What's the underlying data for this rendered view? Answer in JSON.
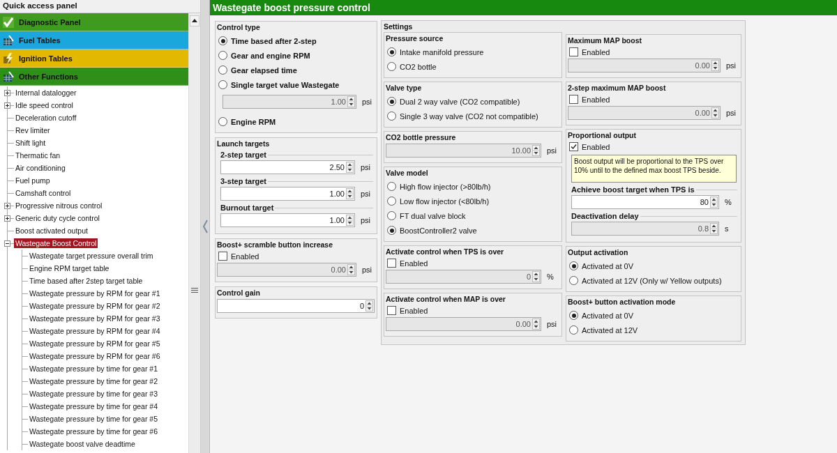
{
  "quick_access_panel": {
    "title": "Quick access panel",
    "categories": [
      {
        "label": "Diagnostic Panel",
        "color": "#3f9b1f"
      },
      {
        "label": "Fuel Tables",
        "color": "#1aa7dc"
      },
      {
        "label": "Ignition Tables",
        "color": "#e2b900"
      },
      {
        "label": "Other Functions",
        "color": "#2f8f19"
      }
    ],
    "tree": [
      {
        "label": "Internal datalogger",
        "expanded": false,
        "selected": false
      },
      {
        "label": "Idle speed control",
        "expanded": false,
        "selected": false
      },
      {
        "label": "Deceleration cutoff",
        "selected": false
      },
      {
        "label": "Rev limiter",
        "selected": false
      },
      {
        "label": "Shift light",
        "selected": false
      },
      {
        "label": "Thermatic fan",
        "selected": false
      },
      {
        "label": "Air conditioning",
        "selected": false
      },
      {
        "label": "Fuel pump",
        "selected": false
      },
      {
        "label": "Camshaft control",
        "selected": false
      },
      {
        "label": "Progressive nitrous control",
        "expanded": false,
        "selected": false
      },
      {
        "label": "Generic duty cycle control",
        "expanded": false,
        "selected": false
      },
      {
        "label": "Boost activated output",
        "selected": false
      },
      {
        "label": "Wastegate Boost Control",
        "expanded": true,
        "selected": true,
        "children": [
          {
            "label": "Wastegate target pressure overall trim",
            "selected": false
          },
          {
            "label": "Engine RPM target table",
            "selected": false
          },
          {
            "label": "Time based after 2step target table",
            "selected": false
          },
          {
            "label": "Wastegate pressure by RPM for gear #1",
            "selected": false
          },
          {
            "label": "Wastegate pressure by RPM for gear #2",
            "selected": false
          },
          {
            "label": "Wastegate pressure by RPM for gear #3",
            "selected": false
          },
          {
            "label": "Wastegate pressure by RPM for gear #4",
            "selected": false
          },
          {
            "label": "Wastegate pressure by RPM for gear #5",
            "selected": false
          },
          {
            "label": "Wastegate pressure by RPM for gear #6",
            "selected": false
          },
          {
            "label": "Wastegate pressure by time for gear #1",
            "selected": false
          },
          {
            "label": "Wastegate pressure by time for gear #2",
            "selected": false
          },
          {
            "label": "Wastegate pressure by time for gear #3",
            "selected": false
          },
          {
            "label": "Wastegate pressure by time for gear #4",
            "selected": false
          },
          {
            "label": "Wastegate pressure by time for gear #5",
            "selected": false
          },
          {
            "label": "Wastegate pressure by time for gear #6",
            "selected": false
          },
          {
            "label": "Wastegate boost valve deadtime",
            "selected": false
          }
        ]
      }
    ]
  },
  "page": {
    "title": "Wastegate boost pressure control",
    "left_groups": [
      {
        "title": "Control type",
        "bold_labels": true,
        "items": [
          {
            "kind": "radio",
            "label": "Time based after 2-step",
            "selected": true
          },
          {
            "kind": "radio",
            "label": "Gear and engine RPM",
            "selected": false
          },
          {
            "kind": "radio",
            "label": "Gear elapsed time",
            "selected": false
          },
          {
            "kind": "radio",
            "label": "Single target value Wastegate",
            "selected": false
          },
          {
            "kind": "field",
            "value": "1.00",
            "unit": "psi",
            "disabled": true
          },
          {
            "kind": "radio",
            "label": "Engine RPM",
            "selected": false
          }
        ]
      },
      {
        "title": "Launch targets",
        "items": [
          {
            "kind": "labeled_field",
            "label": "2-step target",
            "value": "2.50",
            "unit": "psi",
            "disabled": false
          },
          {
            "kind": "labeled_field",
            "label": "3-step target",
            "value": "1.00",
            "unit": "psi",
            "disabled": false
          },
          {
            "kind": "labeled_field",
            "label": "Burnout target",
            "value": "1.00",
            "unit": "psi",
            "disabled": false
          }
        ]
      },
      {
        "title": "Boost+ scramble button increase",
        "items": [
          {
            "kind": "checkbox",
            "label": "Enabled",
            "checked": false
          },
          {
            "kind": "field",
            "value": "0.00",
            "unit": "psi",
            "disabled": true
          }
        ]
      },
      {
        "title": "Control gain",
        "items": [
          {
            "kind": "field",
            "value": "0",
            "disabled": false
          }
        ]
      }
    ],
    "settings": {
      "title": "Settings",
      "columns": [
        [
          {
            "title": "Pressure source",
            "items": [
              {
                "kind": "radio",
                "label": "Intake manifold pressure",
                "selected": true
              },
              {
                "kind": "radio",
                "label": "CO2 bottle",
                "selected": false
              }
            ]
          },
          {
            "title": "Valve type",
            "items": [
              {
                "kind": "radio",
                "label": "Dual 2 way valve (CO2 compatible)",
                "selected": true
              },
              {
                "kind": "radio",
                "label": "Single 3 way valve (CO2 not compatible)",
                "selected": false
              }
            ]
          },
          {
            "title": "CO2 bottle pressure",
            "items": [
              {
                "kind": "field",
                "value": "10.00",
                "unit": "psi",
                "disabled": true
              }
            ]
          },
          {
            "title": "Valve model",
            "items": [
              {
                "kind": "radio",
                "label": "High flow injector (>80lb/h)",
                "selected": false
              },
              {
                "kind": "radio",
                "label": "Low flow injector (<80lb/h)",
                "selected": false
              },
              {
                "kind": "radio",
                "label": "FT dual valve block",
                "selected": false
              },
              {
                "kind": "radio",
                "label": "BoostController2 valve",
                "selected": true
              }
            ]
          },
          {
            "title": "Activate control when TPS is over",
            "items": [
              {
                "kind": "checkbox",
                "label": "Enabled",
                "checked": false
              },
              {
                "kind": "field",
                "value": "0",
                "unit": "%",
                "disabled": true
              }
            ]
          },
          {
            "title": "Activate control when MAP is over",
            "items": [
              {
                "kind": "checkbox",
                "label": "Enabled",
                "checked": false
              },
              {
                "kind": "field",
                "value": "0.00",
                "unit": "psi",
                "disabled": true
              }
            ]
          }
        ],
        [
          {
            "title": "Maximum MAP boost",
            "items": [
              {
                "kind": "checkbox",
                "label": "Enabled",
                "checked": false
              },
              {
                "kind": "field",
                "value": "0.00",
                "unit": "psi",
                "disabled": true
              }
            ]
          },
          {
            "title": "2-step maximum MAP boost",
            "items": [
              {
                "kind": "checkbox",
                "label": "Enabled",
                "checked": false
              },
              {
                "kind": "field",
                "value": "0.00",
                "unit": "psi",
                "disabled": true
              }
            ]
          },
          {
            "title": "Proportional output",
            "items": [
              {
                "kind": "checkbox",
                "label": "Enabled",
                "checked": true
              },
              {
                "kind": "note",
                "text": "Boost output will be proportional to the TPS over 10% until to the defined max boost TPS beside."
              },
              {
                "kind": "labeled_field",
                "label": "Achieve boost target when TPS is",
                "value": "80",
                "unit": "%",
                "disabled": false
              },
              {
                "kind": "labeled_field",
                "label": "Deactivation delay",
                "value": "0.8",
                "unit": "s",
                "disabled": true
              }
            ]
          },
          {
            "title": "Output activation",
            "items": [
              {
                "kind": "radio",
                "label": "Activated at 0V",
                "selected": true
              },
              {
                "kind": "radio",
                "label": "Activated at 12V (Only w/ Yellow outputs)",
                "selected": false
              }
            ]
          },
          {
            "title": "Boost+ button activation mode",
            "items": [
              {
                "kind": "radio",
                "label": "Activated at 0V",
                "selected": true
              },
              {
                "kind": "radio",
                "label": "Activated at 12V",
                "selected": false
              }
            ]
          }
        ]
      ]
    }
  }
}
